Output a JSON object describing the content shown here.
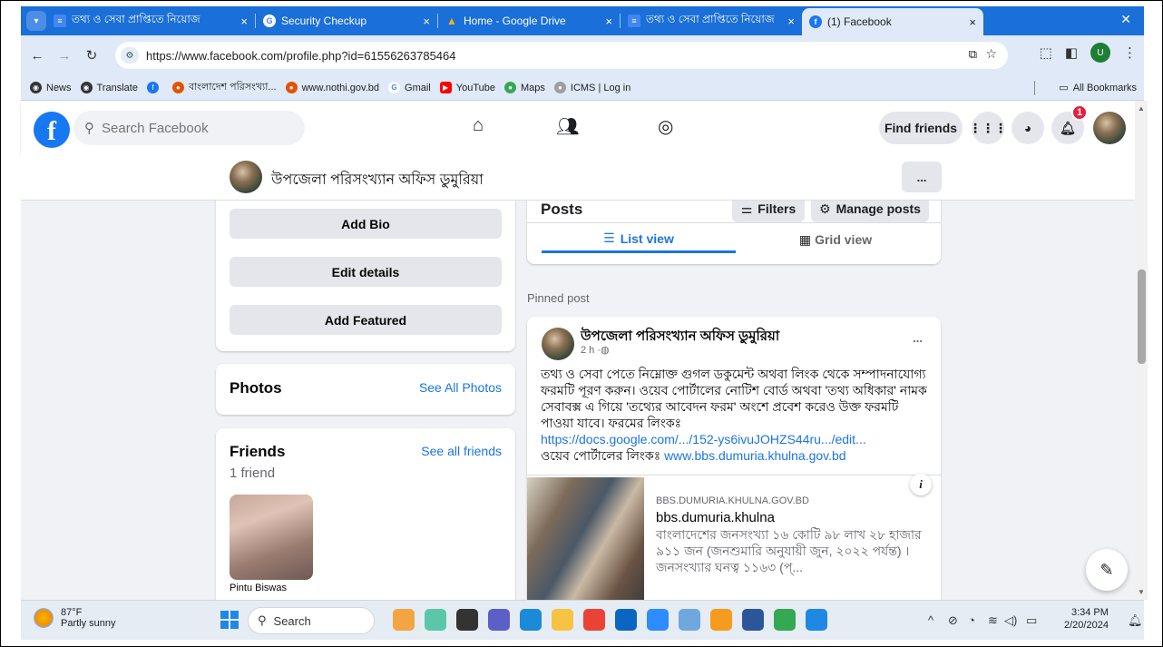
{
  "browser": {
    "tabs": [
      {
        "title": "তথ্য ও সেবা প্রাপ্তিতে নিয়োজ",
        "icon": "google-docs-icon",
        "color": "#4285f4"
      },
      {
        "title": "Security Checkup",
        "icon": "google-icon",
        "color": "#ffffff"
      },
      {
        "title": "Home - Google Drive",
        "icon": "drive-icon",
        "color": "#f4b400"
      },
      {
        "title": "তথ্য ও সেবা প্রাপ্তিতে নিয়োজ",
        "icon": "google-docs-icon",
        "color": "#4285f4"
      },
      {
        "title": "(1) Facebook",
        "icon": "facebook-icon",
        "color": "#1877f2",
        "active": true
      }
    ],
    "url": "https://www.facebook.com/profile.php?id=61556263785464",
    "bookmarks": [
      {
        "label": "News",
        "color": "#333333"
      },
      {
        "label": "Translate",
        "color": "#333333"
      },
      {
        "label": "",
        "color": "#1877f2"
      },
      {
        "label": "বাংলাদেশ পরিসংখ্যা...",
        "color": "#e65100"
      },
      {
        "label": "www.nothi.gov.bd",
        "color": "#e65100"
      },
      {
        "label": "Gmail",
        "color": "#4285f4"
      },
      {
        "label": "YouTube",
        "color": "#ff0000"
      },
      {
        "label": "Maps",
        "color": "#34a853"
      },
      {
        "label": "ICMS | Log in",
        "color": "#9e9e9e"
      }
    ],
    "all_bookmarks": "All Bookmarks",
    "profile_initial": "U"
  },
  "fb": {
    "search_placeholder": "Search Facebook",
    "find_friends": "Find friends",
    "notification_count": "1",
    "brand_color": "#1877f2"
  },
  "profile": {
    "name": "উপজেলা পরিসংখ্যান অফিস ডুমুরিয়া",
    "more": "..."
  },
  "intro": {
    "add_bio": "Add Bio",
    "edit_details": "Edit details",
    "add_featured": "Add Featured"
  },
  "photos": {
    "title": "Photos",
    "see_all": "See All Photos"
  },
  "friends": {
    "title": "Friends",
    "see_all": "See all friends",
    "count": "1 friend",
    "items": [
      {
        "name": "Pintu Biswas"
      }
    ]
  },
  "posts": {
    "title": "Posts",
    "filters": "Filters",
    "manage": "Manage posts",
    "list_view": "List view",
    "grid_view": "Grid view",
    "pinned_label": "Pinned post"
  },
  "post": {
    "author": "উপজেলা পরিসংখ্যান অফিস ডুমুরিয়া",
    "time": "2 h ·",
    "more": "...",
    "body": "তথ্য ও সেবা পেতে নিম্নোক্ত গুগল ডকুমেন্ট অথবা লিংক থেকে সম্পাদনাযোগ্য ফরমটি পূরণ করুন। ওয়েব পোর্টালের নোটিশ বোর্ড অথবা 'তথ্য অধিকার' নামক সেবাবক্স এ গিয়ে 'তথ্যের আবেদন ফরম' অংশে প্রবেশ করেও উক্ত ফরমটি পাওয়া যাবে। ফরমের লিংকঃ",
    "link1": "https://docs.google.com/.../152-ys6ivuJOHZS44ru.../edit...",
    "portal_prefix": "ওয়েব পোর্টালের লিংকঃ",
    "link2": "www.bbs.dumuria.khulna.gov.bd",
    "preview": {
      "domain": "BBS.DUMURIA.KHULNA.GOV.BD",
      "title": "bbs.dumuria.khulna",
      "desc": "বাংলাদেশের জনসংখ্যা ১৬ কোটি ৯৮ লাখ ২৮ হাজার ৯১১ জন (জনশুমারি অনুযায়ী জুন, ২০২২ পর্যন্ত) । জনসংখ্যার ঘনত্ব ১১৬৩ (প্..."
    }
  },
  "taskbar": {
    "temp": "87°F",
    "weather": "Partly sunny",
    "search": "Search",
    "time": "3:34 PM",
    "date": "2/20/2024",
    "apps": [
      {
        "name": "widgets-app-icon",
        "color": "#f2a541"
      },
      {
        "name": "copilot-icon",
        "color": "#5ac8a8"
      },
      {
        "name": "task-view-icon",
        "color": "#333333"
      },
      {
        "name": "meet-icon",
        "color": "#5b5fc7"
      },
      {
        "name": "edge-icon",
        "color": "#1b8ad8"
      },
      {
        "name": "file-explorer-icon",
        "color": "#f6c343"
      },
      {
        "name": "chrome-icon",
        "color": "#ea4335"
      },
      {
        "name": "mail-icon",
        "color": "#0a66c2"
      },
      {
        "name": "zoom-icon",
        "color": "#2d8cff"
      },
      {
        "name": "network-app-icon",
        "color": "#6fa8dc"
      },
      {
        "name": "office-icon",
        "color": "#f79b1e"
      },
      {
        "name": "word-icon",
        "color": "#2b579a"
      },
      {
        "name": "chrome-profile-icon",
        "color": "#34a853"
      },
      {
        "name": "pinned-app-icon",
        "color": "#1e88e5"
      }
    ]
  }
}
